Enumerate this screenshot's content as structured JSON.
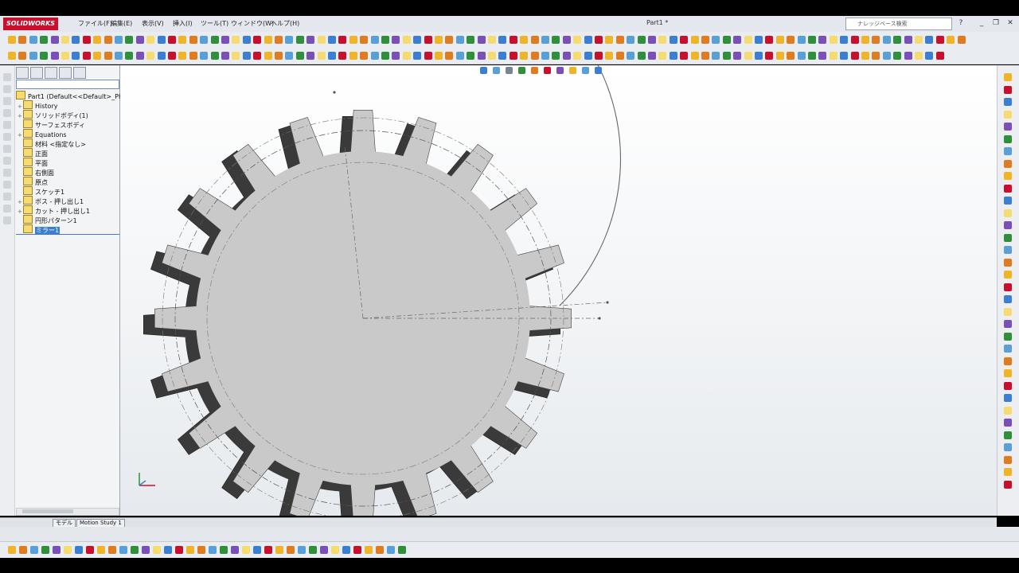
{
  "app": {
    "logo": "SOLIDWORKS",
    "document_title": "Part1 *"
  },
  "menu": [
    "ファイル(F)",
    "編集(E)",
    "表示(V)",
    "挿入(I)",
    "ツール(T)",
    "ウィンドウ(W)",
    "ヘルプ(H)"
  ],
  "search": {
    "placeholder": "ナレッジベース検索"
  },
  "feature_tree": {
    "root": "Part1  (Default<<Default>_Ph",
    "items": [
      {
        "label": "History",
        "expandable": true
      },
      {
        "label": "ソリッドボディ(1)",
        "expandable": true
      },
      {
        "label": "サーフェスボディ",
        "expandable": false
      },
      {
        "label": "Equations",
        "expandable": true
      },
      {
        "label": "材料 <指定なし>",
        "expandable": false
      },
      {
        "label": "正面",
        "expandable": false
      },
      {
        "label": "平面",
        "expandable": false
      },
      {
        "label": "右側面",
        "expandable": false
      },
      {
        "label": "原点",
        "expandable": false
      },
      {
        "label": "スケッチ1",
        "expandable": false
      },
      {
        "label": "ボス - 押し出し1",
        "expandable": true
      },
      {
        "label": "カット - 押し出し1",
        "expandable": true
      },
      {
        "label": "円形パターン1",
        "expandable": false
      },
      {
        "label": "ミラー1",
        "expandable": false,
        "selected": true
      }
    ]
  },
  "bottom_tabs": [
    "モデル",
    "Motion Study 1"
  ],
  "gear": {
    "teeth": 20
  },
  "colors": {
    "gear_face": "#c9c9c9",
    "gear_side": "#3a3a3a",
    "selection": "#3b7fd4",
    "logo": "#c8102e"
  }
}
